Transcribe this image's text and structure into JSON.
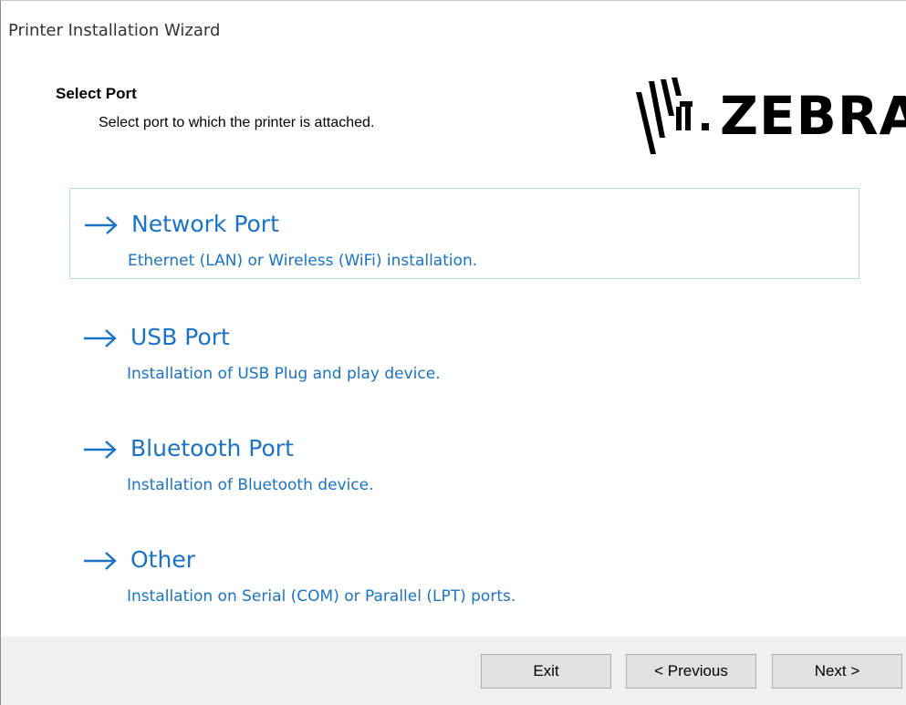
{
  "window": {
    "title": "Printer Installation Wizard"
  },
  "header": {
    "title": "Select Port",
    "subtitle": "Select port to which the printer is attached.",
    "logo_text": "ZEBRA"
  },
  "options": [
    {
      "title": "Network Port",
      "description": "Ethernet (LAN) or Wireless (WiFi) installation.",
      "icon": "arrow-right-icon",
      "selected": true
    },
    {
      "title": "USB Port",
      "description": "Installation of USB Plug and play device.",
      "icon": "arrow-right-icon",
      "selected": false
    },
    {
      "title": "Bluetooth Port",
      "description": "Installation of Bluetooth device.",
      "icon": "arrow-right-icon",
      "selected": false
    },
    {
      "title": "Other",
      "description": "Installation on Serial (COM) or Parallel (LPT) ports.",
      "icon": "arrow-right-icon",
      "selected": false
    }
  ],
  "footer": {
    "exit_label": "Exit",
    "previous_label": "< Previous",
    "next_label": "Next >"
  },
  "colors": {
    "link": "#1a73c6",
    "selected_border": "#b6d4ef",
    "footer_bg": "#f0f0f0",
    "button_bg": "#e1e1e1"
  }
}
